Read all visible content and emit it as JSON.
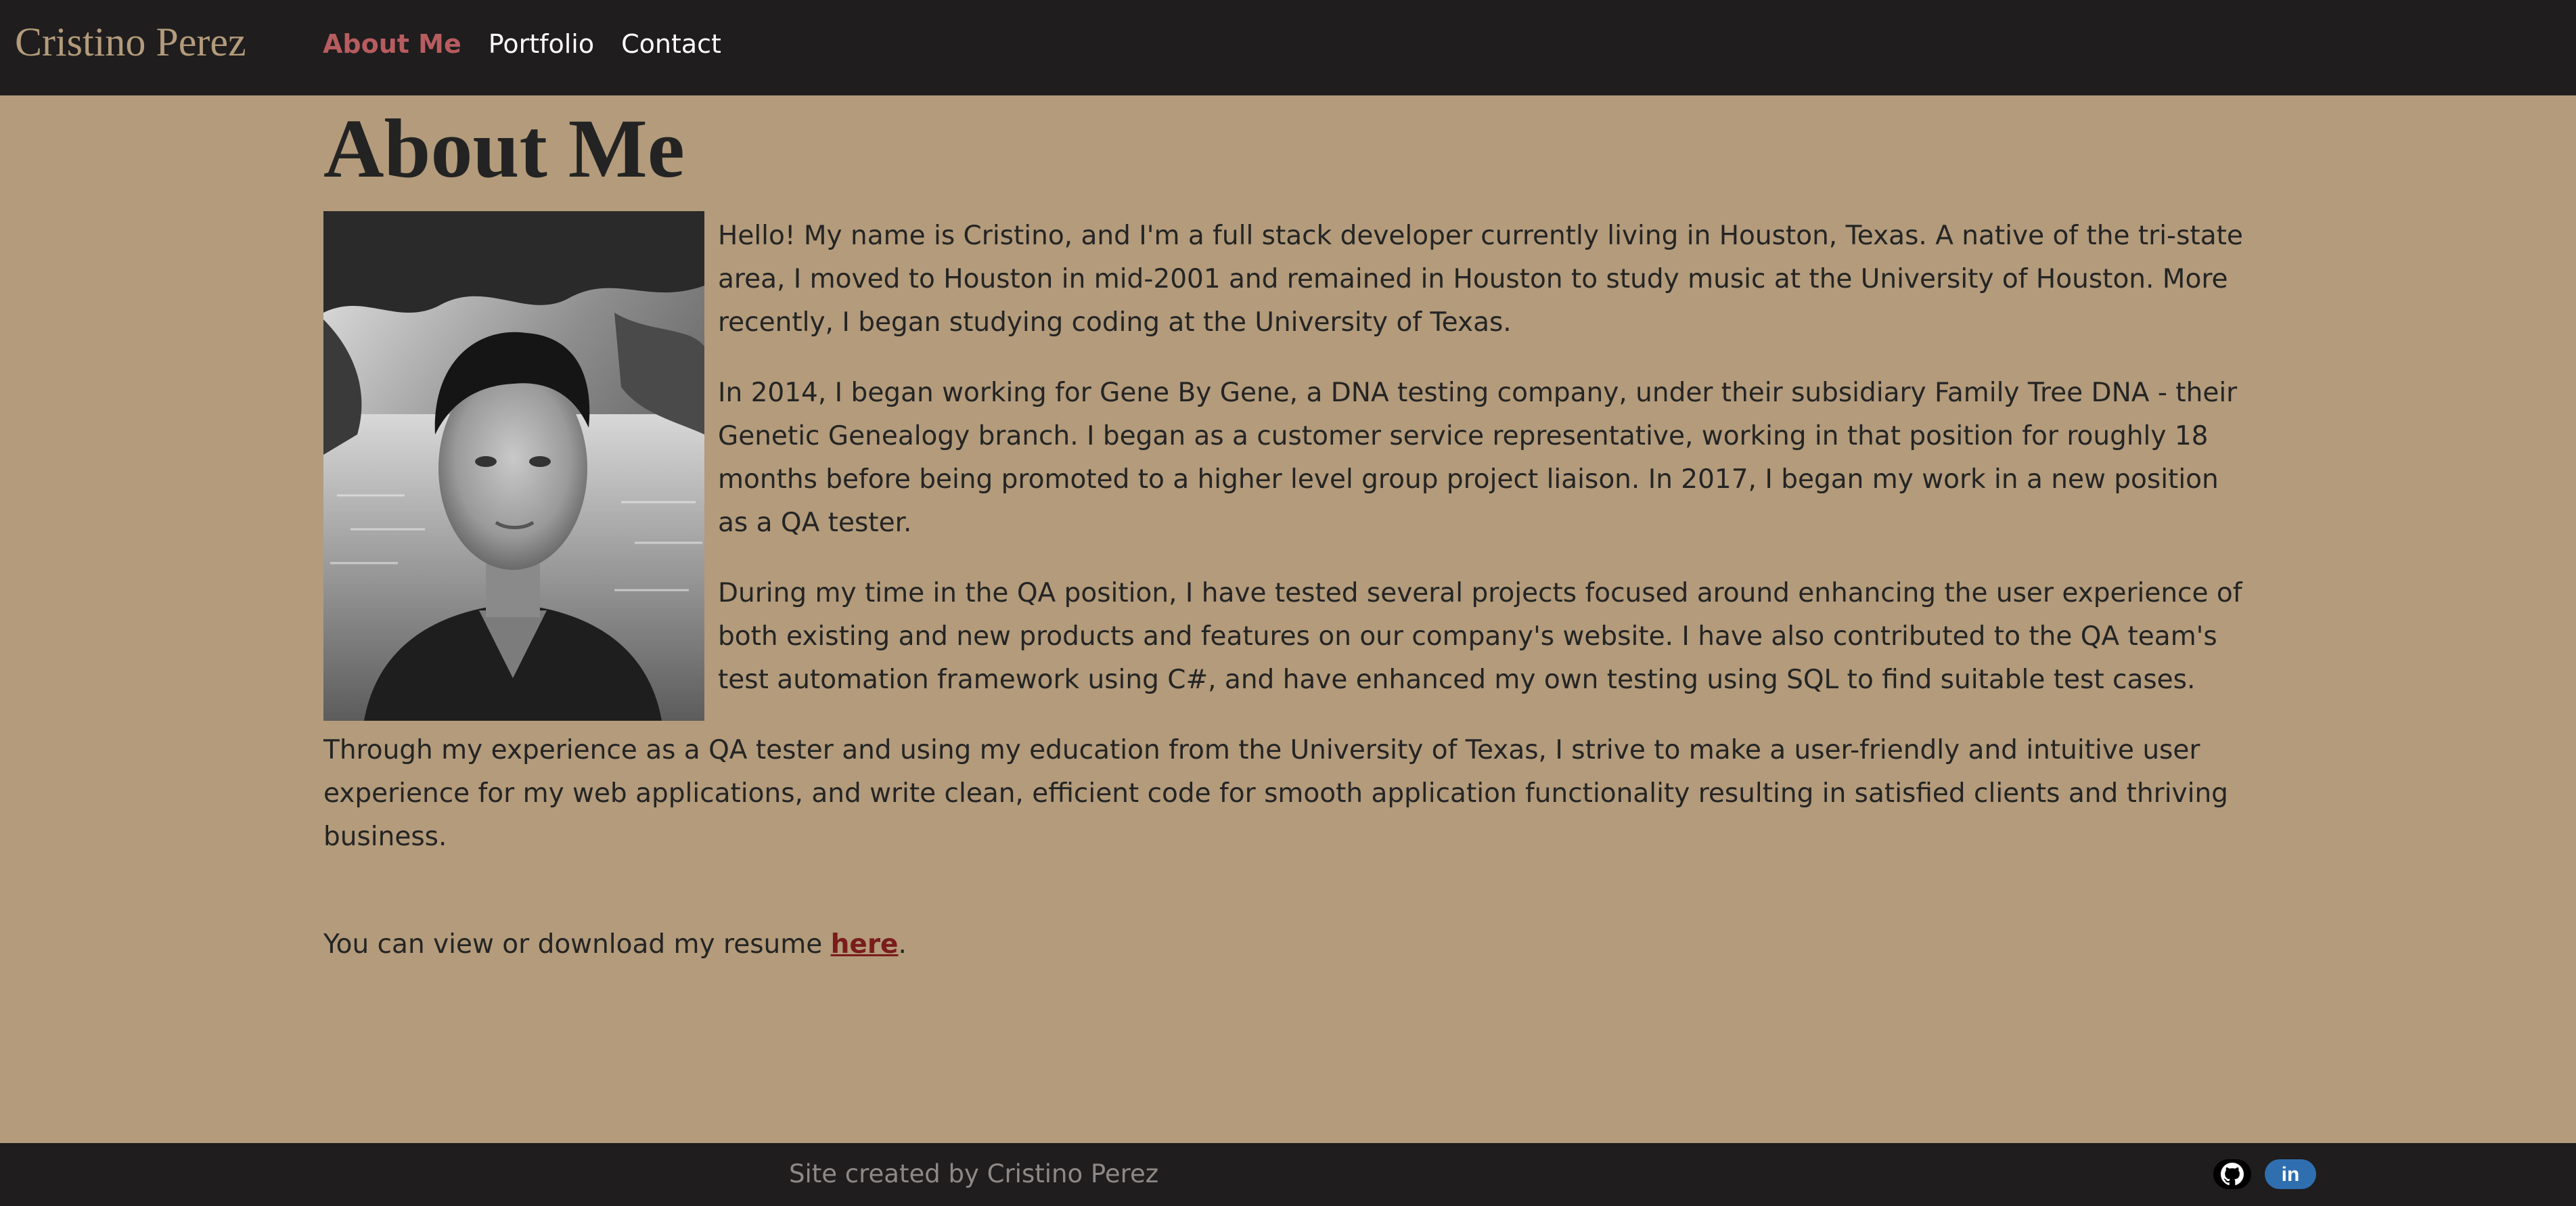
{
  "header": {
    "brand": "Cristino Perez",
    "nav": [
      {
        "label": "About Me",
        "active": true
      },
      {
        "label": "Portfolio",
        "active": false
      },
      {
        "label": "Contact",
        "active": false
      }
    ]
  },
  "main": {
    "title": "About Me",
    "photo_icon": "portrait-photo",
    "paragraphs": [
      "Hello! My name is Cristino, and I'm a full stack developer currently living in Houston, Texas. A native of the tri-state area, I moved to Houston in mid-2001 and remained in Houston to study music at the University of Houston. More recently, I began studying coding at the University of Texas.",
      "In 2014, I began working for Gene By Gene, a DNA testing company, under their subsidiary Family Tree DNA - their Genetic Genealogy branch. I began as a customer service representative, working in that position for roughly 18 months before being promoted to a higher level group project liaison. In 2017, I began my work in a new position as a QA tester.",
      "During my time in the QA position, I have tested several projects focused around enhancing the user experience of both existing and new products and features on our company's website. I have also contributed to the QA team's test automation framework using C#, and have enhanced my own testing using SQL to find suitable test cases.",
      "Through my experience as a QA tester and using my education from the University of Texas, I strive to make a user-friendly and intuitive user experience for my web applications, and write clean, efficient code for smooth application functionality resulting in satisfied clients and thriving business."
    ],
    "resume": {
      "text": "You can view or download my resume ",
      "link_label": "here",
      "suffix": "."
    }
  },
  "footer": {
    "credit": "Site created by Cristino Perez",
    "social": [
      {
        "icon": "github-icon"
      },
      {
        "icon": "linkedin-icon",
        "label": "in"
      }
    ]
  },
  "colors": {
    "background": "#b39b7b",
    "navbar": "#1f1d1e",
    "brand": "#b39b7b",
    "active_nav": "#b75c5f",
    "resume_link": "#7a1c1c",
    "linkedin": "#2f6fb0"
  }
}
